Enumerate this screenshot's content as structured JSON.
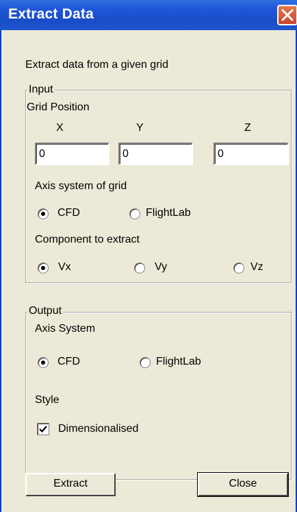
{
  "window": {
    "title": "Extract Data",
    "description": "Extract data from a given grid"
  },
  "input": {
    "legend": "Input",
    "grid_position_label": "Grid Position",
    "x_label": "X",
    "y_label": "Y",
    "z_label": "Z",
    "x_value": "0",
    "y_value": "0",
    "z_value": "0",
    "axis_label": "Axis system of grid",
    "axis_options": [
      {
        "label": "CFD",
        "selected": true
      },
      {
        "label": "FlightLab",
        "selected": false
      }
    ],
    "component_label": "Component to extract",
    "component_options": [
      {
        "label": "Vx",
        "selected": true
      },
      {
        "label": "Vy",
        "selected": false
      },
      {
        "label": "Vz",
        "selected": false
      }
    ]
  },
  "output": {
    "legend": "Output",
    "axis_label": "Axis System",
    "axis_options": [
      {
        "label": "CFD",
        "selected": true
      },
      {
        "label": "FlightLab",
        "selected": false
      }
    ],
    "style_label": "Style",
    "dimensionalised_label": "Dimensionalised",
    "dimensionalised_checked": true
  },
  "buttons": {
    "extract": "Extract",
    "close": "Close"
  },
  "colors": {
    "titlebar": "#1f56d8",
    "close_button": "#d8542f",
    "dialog_background": "#ece9d8"
  }
}
